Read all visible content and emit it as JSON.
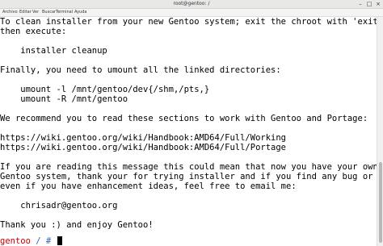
{
  "window": {
    "title": "root@gentoo: /",
    "minimize_glyph": "–",
    "maximize_glyph": "□",
    "close_glyph": "×"
  },
  "menu": {
    "items": [
      "Archivo",
      "Editar",
      "Ver",
      "Buscar",
      "Terminal",
      "Ayuda"
    ]
  },
  "terminal": {
    "lines": [
      "To clean installer from your new Gentoo system; exit the chroot with 'exit',",
      "then execute:",
      "",
      "    installer cleanup",
      "",
      "Finally, you need to umount all the linked directories:",
      "",
      "    umount -l /mnt/gentoo/dev{/shm,/pts,}",
      "    umount -R /mnt/gentoo",
      "",
      "We recommend you to read these sections to work with Gentoo and Portage:",
      "",
      "https://wiki.gentoo.org/wiki/Handbook:AMD64/Full/Working",
      "https://wiki.gentoo.org/wiki/Handbook:AMD64/Full/Portage",
      "",
      "If you are reading this message this could mean that now you have your own",
      "Gentoo system, thank your for trying installer and if you find any bug or error,",
      "even if you have enhancement ideas, feel free to email me:",
      "",
      "    chrisadr@gentoo.org",
      "",
      "Thank you :) and enjoy Gentoo!",
      ""
    ],
    "prompt": {
      "host": "gentoo",
      "path": " / ",
      "symbol": "# "
    }
  },
  "colors": {
    "prompt_host": "#cc0000",
    "prompt_path": "#3465a4",
    "text": "#000000",
    "background": "#ffffff"
  }
}
